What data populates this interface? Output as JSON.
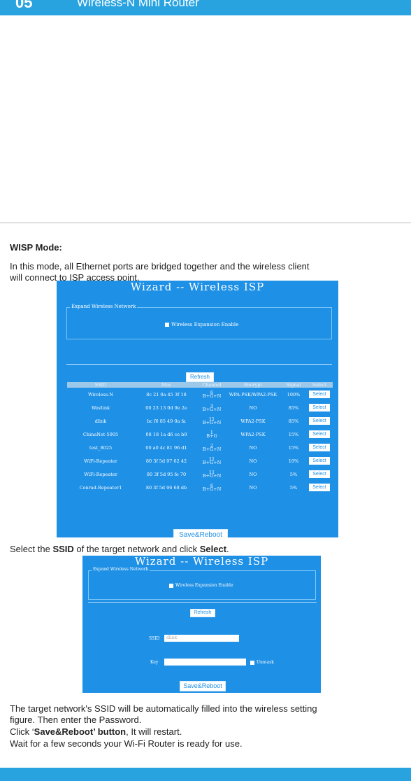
{
  "header": {
    "number": "05",
    "title": "Wireless-N Mini Router"
  },
  "section": {
    "heading": "WISP Mode:",
    "intro_line1": "In this mode, all Ethernet ports are bridged together and the wireless client",
    "intro_line2": "will connect to ISP access point.",
    "select_pre": "Select the ",
    "select_ssid": "SSID",
    "select_mid": " of the target network and click ",
    "select_btn": "Select",
    "select_end": ".",
    "after_line1": "The target network's SSID will be automatically filled into the wireless setting",
    "after_line2": "figure.  Then enter the Password.",
    "click_pre": "Click ‘",
    "click_bold": "Save&Reboot’ button",
    "click_post": ", It will restart.",
    "wait": "Wait for a few seconds your Wi-Fi Router is ready for use."
  },
  "shot1": {
    "title": "Wizard -- Wireless ISP",
    "legend": "Expand Wireless Network",
    "enable": "Wireless Expansion Enable",
    "refresh": "Refresh",
    "save": "Save&Reboot",
    "columns": [
      "SSID",
      "Mac",
      "Channel",
      "Encrypt",
      "Signal",
      "Select"
    ],
    "rows": [
      {
        "ssid": "Wireless-N",
        "mac": "8c 21 0a 45 3f 18",
        "ch": "6",
        "band": "B+G+N",
        "enc": "WPA-PSK/WPA2-PSK",
        "sig": "100%",
        "sel": "Select"
      },
      {
        "ssid": "Wavlink",
        "mac": "00 23 13 0d 9e 2e",
        "ch": "3",
        "band": "B+G+N",
        "enc": "NO",
        "sig": "85%",
        "sel": "Select"
      },
      {
        "ssid": "dlink",
        "mac": "bc f6 85 49 0a fa",
        "ch": "11",
        "band": "B+G+N",
        "enc": "WPA2-PSK",
        "sig": "85%",
        "sel": "Select"
      },
      {
        "ssid": "ChinaNet-5005",
        "mac": "08 18 1a d6 ce b9",
        "ch": "1",
        "band": "B+G",
        "enc": "WPA2-PSK",
        "sig": "15%",
        "sel": "Select"
      },
      {
        "ssid": "test_8025",
        "mac": "00 a0 4c 81 96 d1",
        "ch": "2",
        "band": "B+G+N",
        "enc": "NO",
        "sig": "15%",
        "sel": "Select"
      },
      {
        "ssid": "WiFi-Repeater",
        "mac": "80 3f 5d 97 62 42",
        "ch": "11",
        "band": "B+G+N",
        "enc": "NO",
        "sig": "10%",
        "sel": "Select"
      },
      {
        "ssid": "WiFi-Repeater",
        "mac": "80 3f 5d 95 fe 70",
        "ch": "11",
        "band": "B+G+N",
        "enc": "NO",
        "sig": "5%",
        "sel": "Select"
      },
      {
        "ssid": "Conrad-Repeater1",
        "mac": "80 3f 5d 96 68 db",
        "ch": "6",
        "band": "B+G+N",
        "enc": "NO",
        "sig": "5%",
        "sel": "Select"
      }
    ]
  },
  "shot2": {
    "title": "Wizard -- Wireless ISP",
    "legend": "Expand Wireless Network",
    "enable": "Wireless Expansion Enable",
    "refresh": "Refresh",
    "ssid_label": "SSID",
    "ssid_value": "dlink",
    "key_label": "Key",
    "key_value": "",
    "unmask": "Unmask",
    "save": "Save&Reboot"
  }
}
